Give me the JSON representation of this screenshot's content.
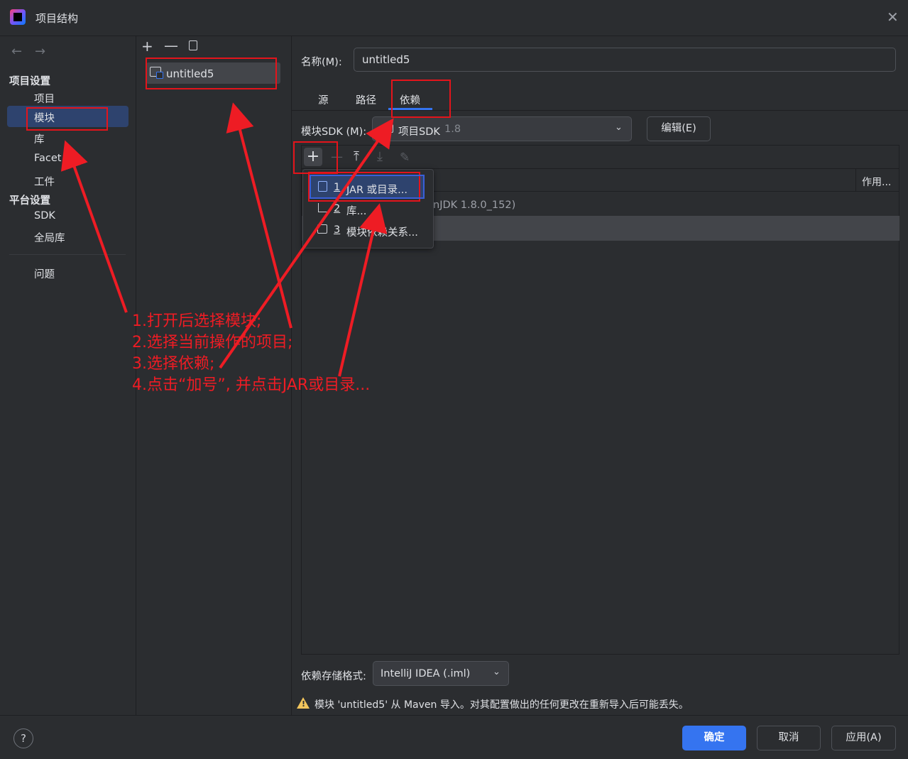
{
  "window": {
    "title": "项目结构"
  },
  "left_nav": {
    "back": "←",
    "forward": "→",
    "project_settings_header": "项目设置",
    "project_items": [
      "项目",
      "模块",
      "库",
      "Facet",
      "工件"
    ],
    "platform_settings_header": "平台设置",
    "platform_items": [
      "SDK",
      "全局库"
    ],
    "problems": "问题"
  },
  "modules": {
    "toolbar": {
      "add": "+",
      "remove": "—"
    },
    "items": [
      "untitled5"
    ]
  },
  "module_detail": {
    "name_label": "名称(M):",
    "name_value": "untitled5",
    "tabs": [
      "源",
      "路径",
      "依赖"
    ],
    "sdk_label": "模块SDK (M):",
    "sdk_value": "项目SDK",
    "sdk_version": "1.8",
    "edit_button": "编辑(E)",
    "scope_header": "作用...",
    "dependency_row": "nJDK 1.8.0_152)",
    "storage_label": "依赖存储格式:",
    "storage_value": "IntelliJ IDEA (.iml)",
    "warning": "模块 'untitled5' 从 Maven 导入。对其配置做出的任何更改在重新导入后可能丢失。"
  },
  "popup_menu": {
    "items": [
      {
        "number": "1",
        "label": "JAR 或目录..."
      },
      {
        "number": "2",
        "label": "库..."
      },
      {
        "number": "3",
        "label": "模块依赖关系..."
      }
    ]
  },
  "footer": {
    "help": "?",
    "ok": "确定",
    "cancel": "取消",
    "apply": "应用(A)"
  },
  "annotation": {
    "lines": [
      "1.打开后选择模块;",
      "2.选择当前操作的项目;",
      "3.选择依赖;",
      "4.点击“加号”,  并点击JAR或目录..."
    ]
  },
  "colors": {
    "accent": "#3574f0",
    "annotation_red": "#ee1c24",
    "background": "#2b2d30"
  }
}
